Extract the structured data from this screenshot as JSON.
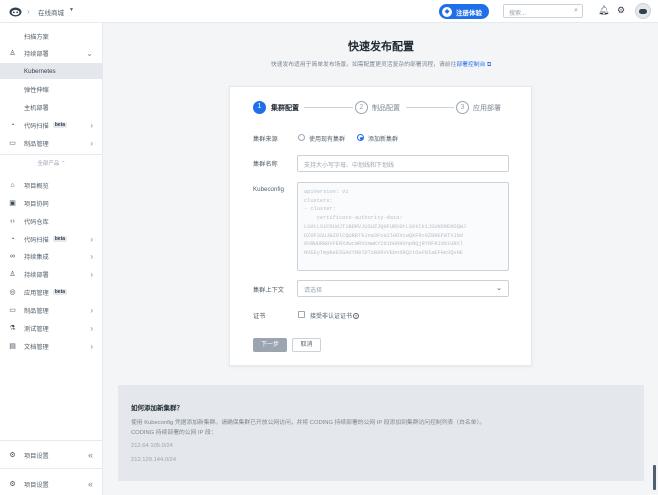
{
  "topbar": {
    "crumb": "在线商城",
    "promo_label": "注册体验",
    "search_placeholder": "搜索..."
  },
  "sidebar": {
    "items": [
      {
        "label": "扫描方案",
        "icon": "none"
      },
      {
        "label": "持续部署",
        "icon": "deploy-icon"
      },
      {
        "label": "Kubernetes",
        "icon": "none"
      },
      {
        "label": "弹性伸缩",
        "icon": "none"
      },
      {
        "label": "主机部署",
        "icon": "none"
      },
      {
        "label": "代码扫描",
        "icon": "scan-icon",
        "badge": "beta"
      },
      {
        "label": "制品管理",
        "icon": "artifact-icon"
      }
    ],
    "group_label": "全部产品",
    "products": [
      {
        "label": "项目概览",
        "icon": "overview-icon"
      },
      {
        "label": "项目协同",
        "icon": "collab-icon"
      },
      {
        "label": "代码仓库",
        "icon": "code-icon"
      },
      {
        "label": "代码扫描",
        "icon": "scan-icon",
        "badge": "beta"
      },
      {
        "label": "持续集成",
        "icon": "ci-icon"
      },
      {
        "label": "持续部署",
        "icon": "deploy-icon"
      },
      {
        "label": "应用管理",
        "icon": "app-icon",
        "badge": "beta"
      },
      {
        "label": "制品管理",
        "icon": "artifact-icon"
      },
      {
        "label": "测试管理",
        "icon": "test-icon"
      },
      {
        "label": "文档管理",
        "icon": "doc-icon"
      }
    ],
    "settings_label_1": "项目设置",
    "settings_label_2": "项目设置"
  },
  "main": {
    "title": "快速发布配置",
    "desc_prefix": "快速发布适用于简单发布场景。如需配置更灵活复杂的部署流程，请前往",
    "desc_link": "部署控制台",
    "steps": [
      {
        "num": "1",
        "label": "集群配置"
      },
      {
        "num": "2",
        "label": "制品配置"
      },
      {
        "num": "3",
        "label": "应用部署"
      }
    ],
    "form": {
      "source_label": "集群来源",
      "source_option_1": "使用现有集群",
      "source_option_2": "添加新集群",
      "name_label": "集群名称",
      "name_placeholder": "支持大小写字母、中划线和下划线",
      "kubeconfig_label": "Kubeconfig",
      "kubeconfig_placeholder": "apiVersion: v1\nclusters:\n- cluster:\n    certificate-authority-data:\nLS0tLS1CRUdJTiBDRVJUSUZJQ0FURS0tLS0tCk1JSUN5RENDQWJ\nDZ0F3SUJBZ0lCQURBTkJna3Foa2lHOXcwQkFRc0ZBREFWTVJNd\n0VRWURWUVFERXdwcmRXSmwKY201bGRHVnpNQjRYRFRJd01URXl\nNVEEyTmpBeE5GAXYR0lDTzB0RVVEbndRQ2tOaFNIaEFHeSQvHE",
      "context_label": "集群上下文",
      "context_placeholder": "请选择",
      "cert_label": "证书",
      "cert_checkbox": "接受非认证证书",
      "next_button": "下一步",
      "cancel_button": "取消"
    },
    "help": {
      "title": "如何添加新集群？",
      "text": "使用 Kubeconfig 凭据添加新集群。请确保集群已开放公网访问，并将 CODING 持续部署的公网 IP 段添加到集群访问控制列表（白名单）。",
      "text2": "CODING 持续部署的公网 IP 段：",
      "ips": [
        "212.64.105.0/24",
        "212.129.144.0/24"
      ]
    }
  },
  "colors": {
    "accent": "#1F6FEB",
    "sidebar_active": "#E4E7EB"
  }
}
